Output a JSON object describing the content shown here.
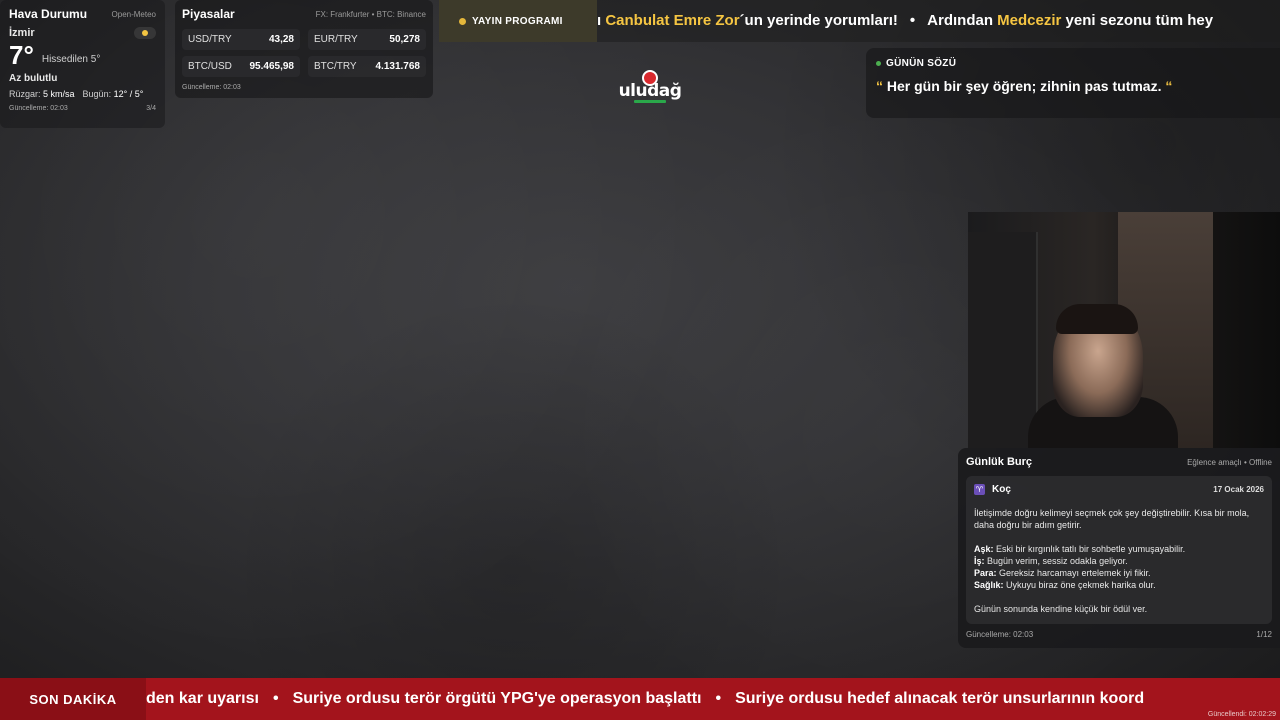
{
  "weather": {
    "title": "Hava Durumu",
    "source": "Open-Meteo",
    "city": "İzmir",
    "temperature": "7°",
    "feels_like": "Hissedilen 5°",
    "condition": "Az bulutlu",
    "wind_label": "Rüzgar:",
    "wind_value": "5 km/sa",
    "today_label": "Bugün:",
    "today_value": "12° / 5°",
    "updated": "Güncelleme: 02:03",
    "page": "3/4",
    "condition_icon": "partly-cloudy-icon"
  },
  "markets": {
    "title": "Piyasalar",
    "source": "FX: Frankfurter • BTC: Binance",
    "items": [
      {
        "label": "USD/TRY",
        "value": "43,28"
      },
      {
        "label": "EUR/TRY",
        "value": "50,278"
      },
      {
        "label": "BTC/USD",
        "value": "95.465,98"
      },
      {
        "label": "BTC/TRY",
        "value": "4.131.768"
      }
    ],
    "updated": "Güncelleme: 02:03"
  },
  "top_ticker": {
    "badge": "YAYIN PROGRAMI",
    "prefix": "ı ",
    "highlight1": "Canbulat Emre Zor",
    "text1": "´un yerinde yorumları!",
    "text2a": "Ardından ",
    "highlight2": "Medcezir",
    "text2b": " yeni sezonu tüm hey",
    "separator": "•"
  },
  "logo": {
    "text": "uludağ"
  },
  "quote": {
    "title": "GÜNÜN SÖZÜ",
    "open_mark": "“",
    "text": " Her gün bir şey öğren; zihnin pas tutmaz. ",
    "close_mark": "“"
  },
  "horoscope": {
    "title": "Günlük Burç",
    "source": "Eğlence amaçlı • Offline",
    "sign": "Koç",
    "sign_icon_glyph": "♈",
    "date": "17 Ocak 2026",
    "intro": "İletişimde doğru kelimeyi seçmek çok şey değiştirebilir. Kısa bir mola, daha doğru bir adım getirir.",
    "love_label": "Aşk:",
    "love": " Eski bir kırgınlık tatlı bir sohbetle yumuşayabilir.",
    "work_label": "İş:",
    "work": " Bugün verim, sessiz odakla geliyor.",
    "money_label": "Para:",
    "money": " Gereksiz harcamayı ertelemek iyi fikir.",
    "health_label": "Sağlık:",
    "health": " Uykuyu biraz öne çekmek harika olur.",
    "outro": "Günün sonunda kendine küçük bir ödül ver.",
    "updated": "Güncelleme: 02:03",
    "page": "1/12"
  },
  "bottom_ticker": {
    "badge": "SON DAKİKA",
    "item1": "den kar uyarısı",
    "item2": "Suriye ordusu terör örgütü YPG'ye operasyon başlattı",
    "item3": "Suriye ordusu hedef alınacak terör unsurlarının koord",
    "separator": "•",
    "updated": "Güncellendi: 02:02:29"
  }
}
